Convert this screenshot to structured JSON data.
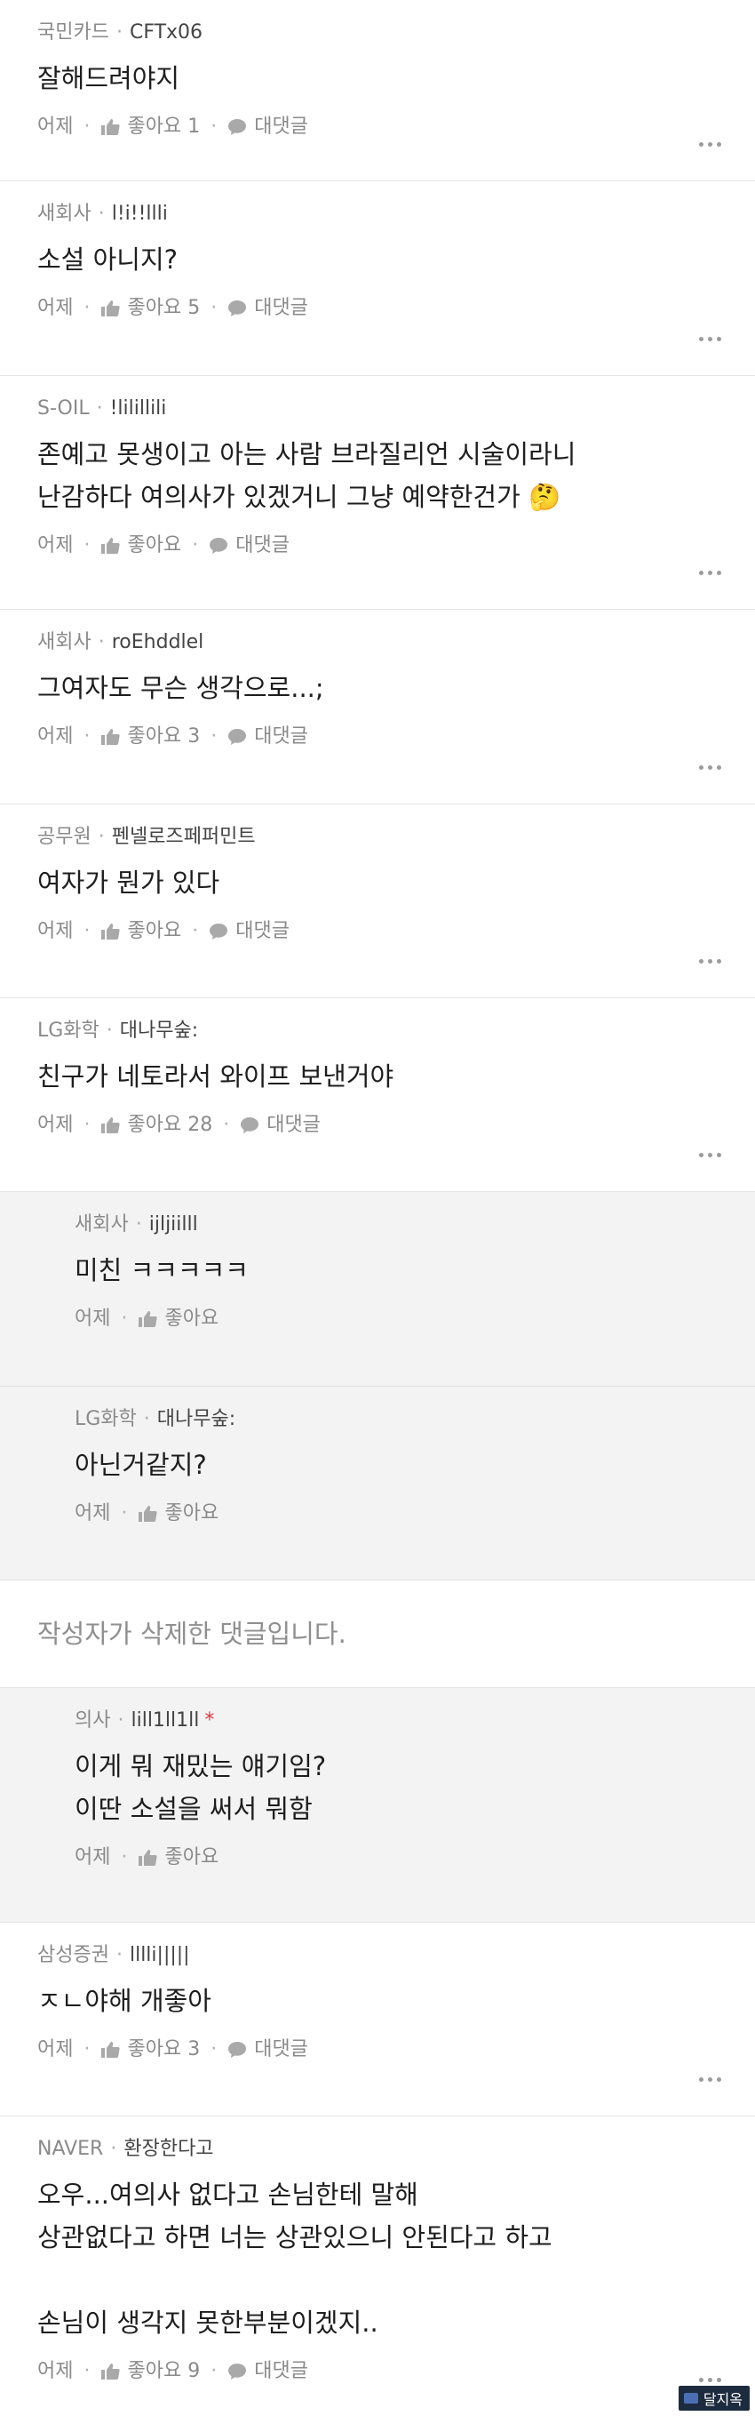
{
  "comments": [
    {
      "company": "국민카드",
      "nick": "CFTx06",
      "lines": [
        "잘해드려야지"
      ],
      "time": "어제",
      "like": "좋아요 1",
      "reply": "대댓글"
    },
    {
      "company": "새회사",
      "nick": "l!i!!llli",
      "lines": [
        "소설 아니지?"
      ],
      "time": "어제",
      "like": "좋아요 5",
      "reply": "대댓글"
    },
    {
      "company": "S-OIL",
      "nick": "!lilillili",
      "lines": [
        "존예고 못생이고 아는 사람 브라질리언 시술이라니",
        "난감하다 여의사가 있겠거니 그냥 예약한건가 🤔"
      ],
      "time": "어제",
      "like": "좋아요",
      "reply": "대댓글"
    },
    {
      "company": "새회사",
      "nick": "roEhddlel",
      "lines": [
        "그여자도 무슨 생각으로...;"
      ],
      "time": "어제",
      "like": "좋아요 3",
      "reply": "대댓글"
    },
    {
      "company": "공무원",
      "nick": "펜넬로즈페퍼민트",
      "lines": [
        "여자가 뭔가 있다"
      ],
      "time": "어제",
      "like": "좋아요",
      "reply": "대댓글"
    },
    {
      "company": "LG화학",
      "nick": "대나무숲:",
      "lines": [
        "친구가 네토라서 와이프 보낸거야"
      ],
      "time": "어제",
      "like": "좋아요 28",
      "reply": "대댓글"
    }
  ],
  "replies_1": [
    {
      "company": "새회사",
      "nick": "ijljiilll",
      "lines": [
        "미친 ㅋㅋㅋㅋㅋ"
      ],
      "time": "어제",
      "like": "좋아요"
    },
    {
      "company": "LG화학",
      "nick": "대나무숲:",
      "lines": [
        "아닌거같지?"
      ],
      "time": "어제",
      "like": "좋아요"
    }
  ],
  "deleted_text": "작성자가 삭제한 댓글입니다.",
  "replies_2": [
    {
      "company": "의사",
      "nick": "lill1ll1ll",
      "star": "*",
      "lines": [
        "이게 뭐 재밌는 얘기임?",
        "이딴 소설을 써서 뭐함"
      ],
      "time": "어제",
      "like": "좋아요"
    }
  ],
  "comments_2": [
    {
      "company": "삼성증권",
      "nick": "lllli|||||",
      "lines": [
        "ㅈㄴ야해 개좋아"
      ],
      "time": "어제",
      "like": "좋아요 3",
      "reply": "대댓글"
    },
    {
      "company": "NAVER",
      "nick": "환장한다고",
      "lines": [
        "오우...여의사 없다고 손님한테 말해",
        "상관없다고 하면 너는 상관있으니 안된다고 하고",
        "",
        "손님이 생각지 못한부분이겠지.."
      ],
      "time": "어제",
      "like": "좋아요 9",
      "reply": "대댓글"
    }
  ],
  "watermark": "달지옥"
}
